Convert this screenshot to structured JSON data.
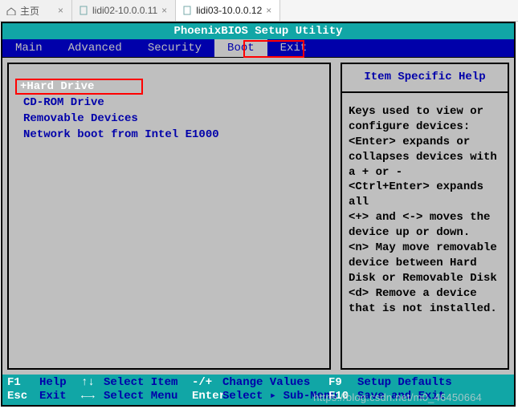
{
  "browser_tabs": [
    {
      "label": "主页",
      "active": false,
      "icon": "home"
    },
    {
      "label": "lidi02-10.0.0.11",
      "active": false,
      "icon": "page"
    },
    {
      "label": "lidi03-10.0.0.12",
      "active": true,
      "icon": "page"
    }
  ],
  "bios": {
    "title": "PhoenixBIOS Setup Utility",
    "menu": [
      "Main",
      "Advanced",
      "Security",
      "Boot",
      "Exit"
    ],
    "menu_selected_index": 3,
    "boot_items": [
      {
        "label": "+Hard Drive",
        "selected": true
      },
      {
        "label": "CD-ROM Drive",
        "selected": false
      },
      {
        "label": "Removable Devices",
        "selected": false
      },
      {
        "label": "Network boot from Intel E1000",
        "selected": false
      }
    ],
    "help": {
      "title": "Item Specific Help",
      "body": "Keys used to view or configure devices:\n<Enter> expands or collapses devices with a + or -\n<Ctrl+Enter> expands all\n<+> and <-> moves the device up or down.\n<n> May move removable device between Hard Disk or Removable Disk\n<d> Remove a device that is not installed."
    },
    "footer": {
      "row1": {
        "k1": "F1",
        "v1": "Help",
        "arr": "↑↓",
        "v2": "Select Item",
        "pm": "-/+",
        "v3": "Change Values",
        "k2": "F9",
        "v4": "Setup Defaults"
      },
      "row2": {
        "k1": "Esc",
        "v1": "Exit",
        "arr": "←→",
        "v2": "Select Menu",
        "pm": "Enter",
        "v3": "Select ▸ Sub-Menu",
        "k2": "F10",
        "v4": "Save and Exit"
      }
    }
  },
  "watermark": "https://blog.csdn.net/m0_46450664"
}
